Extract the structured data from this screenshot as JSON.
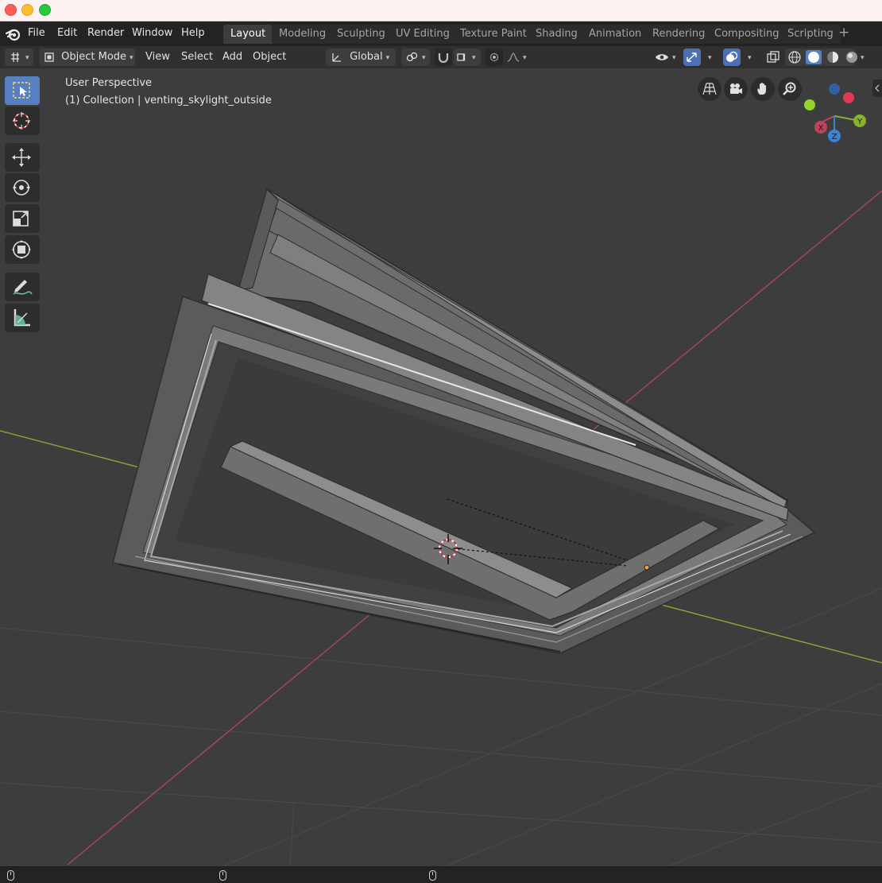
{
  "menu": [
    "File",
    "Edit",
    "Render",
    "Window",
    "Help"
  ],
  "workspaces": [
    {
      "label": "Layout",
      "active": true
    },
    {
      "label": "Modeling",
      "active": false
    },
    {
      "label": "Sculpting",
      "active": false
    },
    {
      "label": "UV Editing",
      "active": false
    },
    {
      "label": "Texture Paint",
      "active": false
    },
    {
      "label": "Shading",
      "active": false
    },
    {
      "label": "Animation",
      "active": false
    },
    {
      "label": "Rendering",
      "active": false
    },
    {
      "label": "Compositing",
      "active": false
    },
    {
      "label": "Scripting",
      "active": false
    }
  ],
  "workspace_add": "+",
  "header": {
    "mode": "Object Mode",
    "view": "View",
    "select": "Select",
    "add": "Add",
    "object": "Object",
    "orientation": "Global"
  },
  "viewport": {
    "perspective": "User Perspective",
    "collection": "(1) Collection | venting_skylight_outside"
  },
  "gizmo": {
    "x": "X",
    "y": "Y",
    "z": "Z"
  },
  "colors": {
    "x_axis": "#c0435a",
    "y_axis": "#86b22f",
    "z_axis": "#3a84d8",
    "active_tool": "#5680c2"
  },
  "tools": [
    "select-box-icon",
    "cursor-icon",
    "move-icon",
    "rotate-icon",
    "scale-icon",
    "transform-icon",
    "annotate-icon",
    "measure-icon"
  ]
}
